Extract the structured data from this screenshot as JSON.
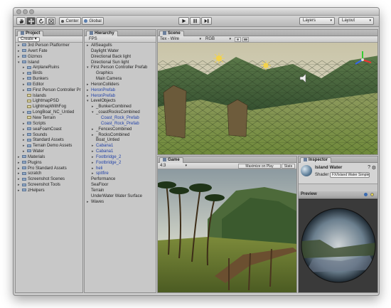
{
  "toolbar": {
    "pivot": "Center",
    "space": "Global",
    "layers": "Layers",
    "layout": "Layout"
  },
  "project": {
    "tab": "Project",
    "create": "Create ▾",
    "items": [
      {
        "label": "3rd Person Platformer",
        "indent": 0,
        "type": "folder",
        "expanded": false
      },
      {
        "label": "Avert Fate",
        "indent": 0,
        "type": "folder",
        "expanded": false
      },
      {
        "label": "Gizmos",
        "indent": 0,
        "type": "folder",
        "expanded": false
      },
      {
        "label": "Island",
        "indent": 0,
        "type": "folder",
        "expanded": true
      },
      {
        "label": "AirplaneRuins",
        "indent": 1,
        "type": "folder",
        "expanded": false
      },
      {
        "label": "Birds",
        "indent": 1,
        "type": "folder",
        "expanded": false
      },
      {
        "label": "Bunkers",
        "indent": 1,
        "type": "folder",
        "expanded": false
      },
      {
        "label": "Editor",
        "indent": 1,
        "type": "folder",
        "expanded": false
      },
      {
        "label": "First Person Controller Pr",
        "indent": 1,
        "type": "folder",
        "expanded": false
      },
      {
        "label": "Islands",
        "indent": 1,
        "type": "asset",
        "expanded": false
      },
      {
        "label": "LightmapPSD",
        "indent": 1,
        "type": "asset",
        "expanded": false
      },
      {
        "label": "LightmapWithFog",
        "indent": 1,
        "type": "asset",
        "expanded": false
      },
      {
        "label": "LongBoat_NC_Untied",
        "indent": 1,
        "type": "folder",
        "expanded": false
      },
      {
        "label": "New Terrain",
        "indent": 1,
        "type": "asset",
        "expanded": false
      },
      {
        "label": "Scripts",
        "indent": 1,
        "type": "folder",
        "expanded": false
      },
      {
        "label": "seaFoamCoast",
        "indent": 1,
        "type": "folder",
        "expanded": false
      },
      {
        "label": "Sounds",
        "indent": 1,
        "type": "folder",
        "expanded": false
      },
      {
        "label": "Standard Assets",
        "indent": 1,
        "type": "folder",
        "expanded": false
      },
      {
        "label": "Terrain Demo Assets",
        "indent": 1,
        "type": "folder",
        "expanded": false
      },
      {
        "label": "Water",
        "indent": 1,
        "type": "folder",
        "expanded": false
      },
      {
        "label": "Materials",
        "indent": 0,
        "type": "folder",
        "expanded": false
      },
      {
        "label": "Plugins",
        "indent": 0,
        "type": "folder",
        "expanded": false
      },
      {
        "label": "Pro Standard Assets",
        "indent": 0,
        "type": "folder",
        "expanded": false
      },
      {
        "label": "scratch",
        "indent": 0,
        "type": "folder",
        "expanded": false
      },
      {
        "label": "Screenshot Scenes",
        "indent": 0,
        "type": "folder",
        "expanded": false
      },
      {
        "label": "Screenshot Tools",
        "indent": 0,
        "type": "folder",
        "expanded": false
      },
      {
        "label": "zHelpers",
        "indent": 0,
        "type": "folder",
        "expanded": false
      }
    ]
  },
  "hierarchy": {
    "tab": "Hierarchy",
    "filter": "FPS",
    "items": [
      {
        "label": "AllSeagulls",
        "indent": 0,
        "blue": false,
        "arrow": "right"
      },
      {
        "label": "Daylight Water",
        "indent": 0,
        "blue": false,
        "arrow": ""
      },
      {
        "label": "Directional Back light",
        "indent": 0,
        "blue": false,
        "arrow": ""
      },
      {
        "label": "Directional Sun light",
        "indent": 0,
        "blue": false,
        "arrow": ""
      },
      {
        "label": "First Person Controller Prefab",
        "indent": 0,
        "blue": false,
        "arrow": "down"
      },
      {
        "label": "Graphics",
        "indent": 1,
        "blue": false,
        "arrow": ""
      },
      {
        "label": "Main Camera",
        "indent": 1,
        "blue": false,
        "arrow": ""
      },
      {
        "label": "HeronColliders",
        "indent": 0,
        "blue": false,
        "arrow": "right"
      },
      {
        "label": "HeronPrefab",
        "indent": 0,
        "blue": true,
        "arrow": "right"
      },
      {
        "label": "HeronPrefab",
        "indent": 0,
        "blue": true,
        "arrow": "right"
      },
      {
        "label": "LevelObjects",
        "indent": 0,
        "blue": false,
        "arrow": "down"
      },
      {
        "label": "_BunkerCombined",
        "indent": 1,
        "blue": false,
        "arrow": "right"
      },
      {
        "label": "_coastRocksCombined",
        "indent": 1,
        "blue": false,
        "arrow": "down"
      },
      {
        "label": "Coast_Rock_Prefab",
        "indent": 2,
        "blue": true,
        "arrow": ""
      },
      {
        "label": "Coast_Rock_Prefab",
        "indent": 2,
        "blue": true,
        "arrow": ""
      },
      {
        "label": "_FencesCombined",
        "indent": 1,
        "blue": false,
        "arrow": "right"
      },
      {
        "label": "_RocksCombined",
        "indent": 1,
        "blue": false,
        "arrow": "right"
      },
      {
        "label": "Boat_Untied",
        "indent": 1,
        "blue": false,
        "arrow": ""
      },
      {
        "label": "Cabana1",
        "indent": 1,
        "blue": true,
        "arrow": "right"
      },
      {
        "label": "Cabana1",
        "indent": 1,
        "blue": true,
        "arrow": "right"
      },
      {
        "label": "Footbridge_2",
        "indent": 1,
        "blue": true,
        "arrow": "right"
      },
      {
        "label": "Footbridge_2",
        "indent": 1,
        "blue": true,
        "arrow": "right"
      },
      {
        "label": "heli",
        "indent": 1,
        "blue": true,
        "arrow": "right"
      },
      {
        "label": "spitfire",
        "indent": 1,
        "blue": true,
        "arrow": "right"
      },
      {
        "label": "Performance",
        "indent": 0,
        "blue": false,
        "arrow": ""
      },
      {
        "label": "SeaFloor",
        "indent": 0,
        "blue": false,
        "arrow": ""
      },
      {
        "label": "Terrain",
        "indent": 0,
        "blue": false,
        "arrow": ""
      },
      {
        "label": "UnderWater Water Surface",
        "indent": 0,
        "blue": false,
        "arrow": ""
      },
      {
        "label": "Waves",
        "indent": 0,
        "blue": false,
        "arrow": "right"
      }
    ]
  },
  "scene": {
    "tab": "Scene",
    "draw_mode": "Tex - Wire",
    "render_mode": "RGB"
  },
  "game": {
    "tab": "Game",
    "aspect": "4:3",
    "maximize": "Maximize on Play",
    "stats": "Stats"
  },
  "inspector": {
    "tab": "Inspector",
    "object_name": "Island Water",
    "shader_label": "Shader",
    "shader_value": "FX/Island Water Simple",
    "preview_label": "Preview"
  }
}
